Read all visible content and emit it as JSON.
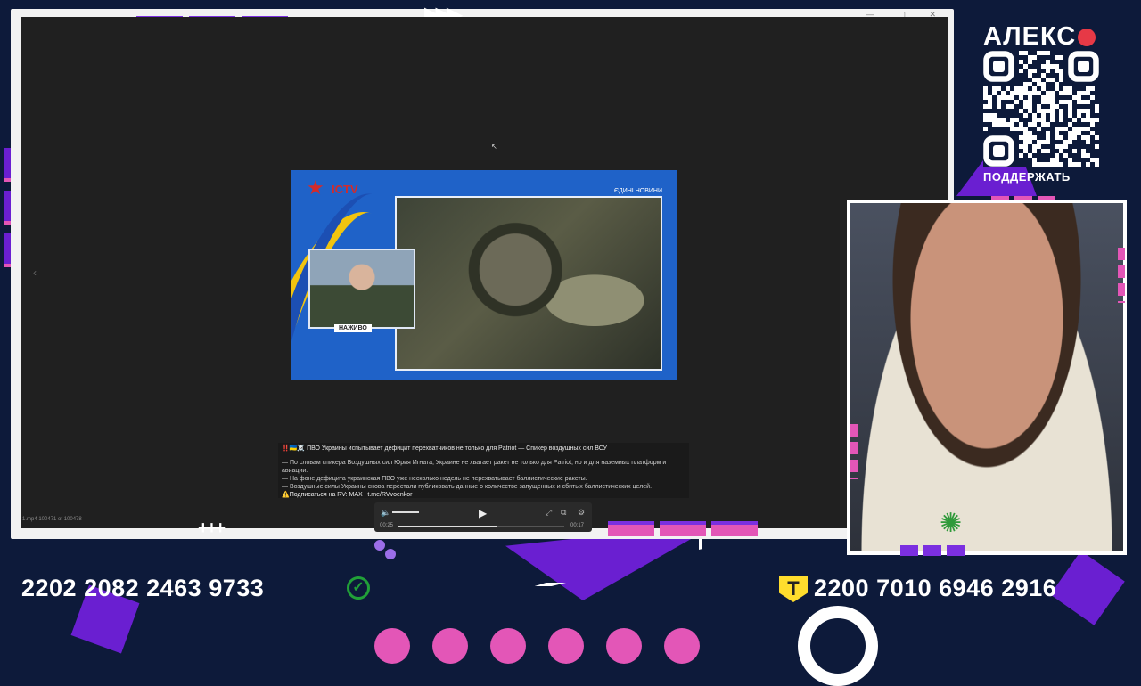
{
  "window": {
    "controls": "— ▢ ✕"
  },
  "video": {
    "channel_logo": "ICTV",
    "channel_star": "★",
    "news_badge": "ЄДИНІ НОВИНИ",
    "live_label": "НАЖИВО"
  },
  "caption": {
    "headline": "‼️🇺🇦☠️ ПВО Украины испытывает дефицит перехватчиков не только для Patriot — Спикер воздушных сил ВСУ",
    "lines": [
      "— По словам спикера Воздушных сил Юрия Игната, Украине не хватает ракет не только для Patriot, но и для наземных платформ и авиации.",
      "— На фоне дефицита украинская ПВО уже несколько недель не перехватывает баллистические ракеты.",
      "— Воздушные силы Украины снова перестали публиковать данные о количестве запущенных и сбитых баллистических целей."
    ],
    "subscribe": "⚠️Подписаться на RV: MAX | t.me/RVvoenkor"
  },
  "player": {
    "time_current": "00:25",
    "time_total": "00:17",
    "progress": 0.59,
    "volume_icon": "🔈",
    "play_icon": "▶",
    "fullscreen_icon": "⤢",
    "pip_icon": "⧉",
    "settings_icon": "⚙"
  },
  "file_info": {
    "name": "1.mp4 100471 of 100478"
  },
  "donate": {
    "brand": "АЛЕКС",
    "support_label": "ПОДДЕРЖАТЬ",
    "card_left": "2202 2082 2463 9733",
    "card_right": "2200 7010 6946 2916",
    "sber_glyph": "✓",
    "tbank_glyph": "T"
  },
  "colors": {
    "background": "#0d1a3a",
    "accent_purple": "#6a1fd1",
    "accent_pink": "#e356b7"
  }
}
